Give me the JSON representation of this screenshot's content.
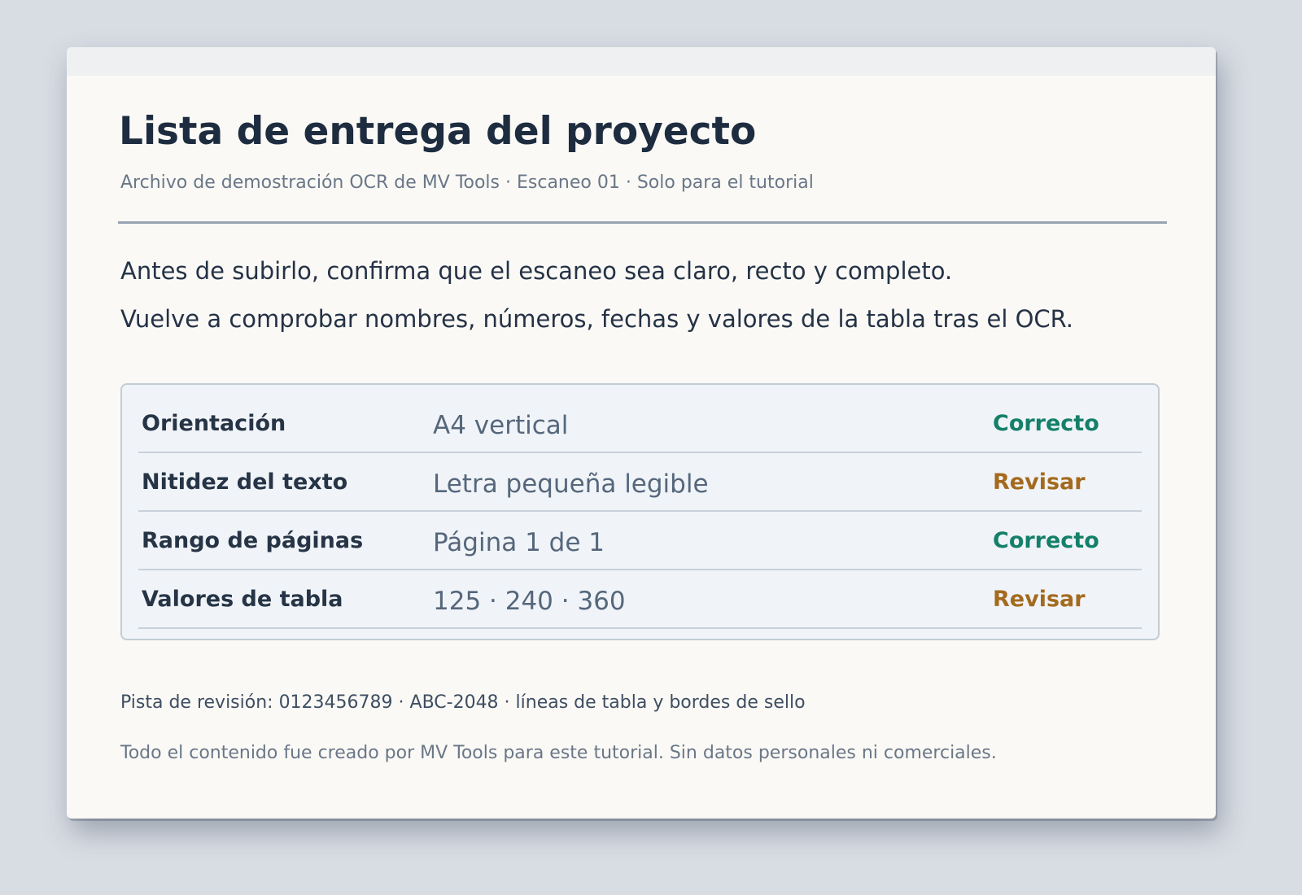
{
  "document": {
    "title": "Lista de entrega del proyecto",
    "subtitle": "Archivo de demostración OCR de MV Tools  ·  Escaneo 01  ·  Solo para el tutorial",
    "instructions": [
      "Antes de subirlo, confirma que el escaneo sea claro, recto y completo.",
      "Vuelve a comprobar nombres, números, fechas y valores de la tabla tras el OCR."
    ],
    "table": {
      "rows": [
        {
          "label": "Orientación",
          "value": "A4 vertical",
          "status": "Correcto",
          "status_kind": "ok"
        },
        {
          "label": "Nitidez del texto",
          "value": "Letra pequeña legible",
          "status": "Revisar",
          "status_kind": "review"
        },
        {
          "label": "Rango de páginas",
          "value": "Página 1 de 1",
          "status": "Correcto",
          "status_kind": "ok"
        },
        {
          "label": "Valores de tabla",
          "value": "125 · 240 · 360",
          "status": "Revisar",
          "status_kind": "review"
        }
      ]
    },
    "review_hint": "Pista de revisión: 0123456789  ·  ABC-2048  ·  líneas de tabla y bordes de sello",
    "footer": "Todo el contenido fue creado por MV Tools para este tutorial. Sin datos personales ni comerciales."
  },
  "colors": {
    "status_ok": "#15806a",
    "status_review": "#a46a1e",
    "title": "#1e2c40",
    "background": "#d8dde4",
    "paper": "#faf9f5"
  }
}
